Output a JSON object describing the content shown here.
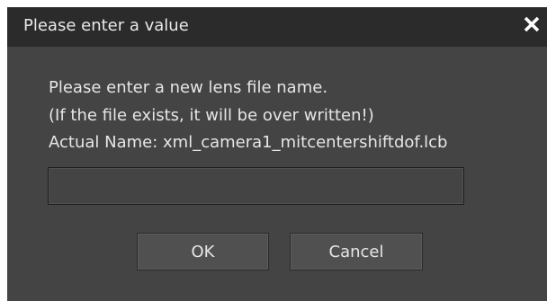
{
  "dialog": {
    "title": "Please enter a value",
    "close_icon": "close-icon",
    "message_line1": "Please enter a new lens file name.",
    "message_line2": "(If the file exists, it will be over written!)",
    "message_line3": "Actual Name: xml_camera1_mitcentershiftdof.lcb",
    "input_value": "",
    "input_placeholder": "",
    "ok_label": "OK",
    "cancel_label": "Cancel"
  },
  "colors": {
    "titlebar": "#2b2b2b",
    "body": "#444444",
    "text": "#e6e6e6",
    "button": "#505050"
  }
}
